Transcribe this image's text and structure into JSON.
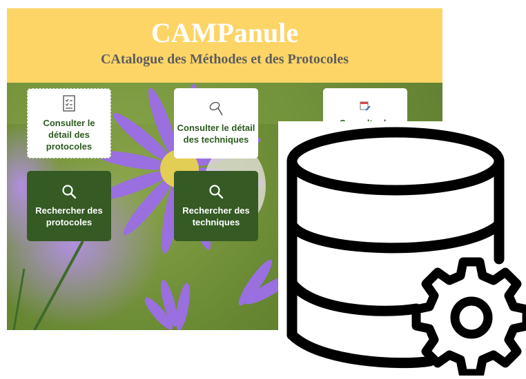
{
  "banner": {
    "title": "CAMPanule",
    "subtitle": "CAtalogue des Méthodes et des Protocoles"
  },
  "tiles": [
    {
      "label": "Consulter le détail des protocoles",
      "icon": "document-list-icon",
      "style": "light"
    },
    {
      "label": "Consulter le détail des techniques",
      "icon": "butterfly-net-icon",
      "style": "light"
    },
    {
      "label": "Consulter le",
      "icon": "calendar-edit-icon",
      "style": "light"
    },
    {
      "label": "Rechercher des protocoles",
      "icon": "search-icon",
      "style": "dark"
    },
    {
      "label": "Rechercher des techniques",
      "icon": "search-icon",
      "style": "dark"
    }
  ],
  "overlay": {
    "icon": "database-gear-icon"
  },
  "colors": {
    "banner_bg": "#fdd567",
    "title": "#ffffff",
    "subtitle": "#5d5d5d",
    "light_tile_text": "#2b5a1e",
    "dark_tile_bg": "#355a24",
    "flower_purple": "#9a6fe0"
  }
}
